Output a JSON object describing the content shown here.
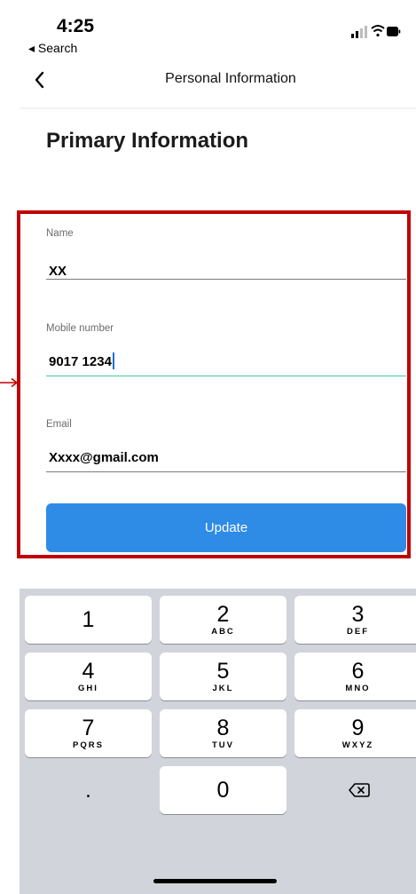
{
  "status_bar": {
    "time": "4:25",
    "back_app": "◂ Search"
  },
  "nav": {
    "title": "Personal Information"
  },
  "page": {
    "heading": "Primary Information"
  },
  "form": {
    "name_label": "Name",
    "name_value": "XX",
    "mobile_label": "Mobile number",
    "mobile_value": "9017 1234",
    "email_label": "Email",
    "email_value": "Xxxx@gmail.com",
    "update_label": "Update"
  },
  "keypad": {
    "keys": [
      {
        "digit": "1",
        "letters": ""
      },
      {
        "digit": "2",
        "letters": "ABC"
      },
      {
        "digit": "3",
        "letters": "DEF"
      },
      {
        "digit": "4",
        "letters": "GHI"
      },
      {
        "digit": "5",
        "letters": "JKL"
      },
      {
        "digit": "6",
        "letters": "MNO"
      },
      {
        "digit": "7",
        "letters": "PQRS"
      },
      {
        "digit": "8",
        "letters": "TUV"
      },
      {
        "digit": "9",
        "letters": "WXYZ"
      }
    ],
    "dot": ".",
    "zero": "0"
  },
  "colors": {
    "accent": "#2e8be6",
    "highlight": "#c00000",
    "focus_line": "#3ec8a2",
    "keypad_bg": "#d1d4da"
  },
  "icons": [
    "back-chevron-icon",
    "signal-icon",
    "wifi-icon",
    "battery-icon",
    "backspace-icon",
    "arrow-icon"
  ]
}
